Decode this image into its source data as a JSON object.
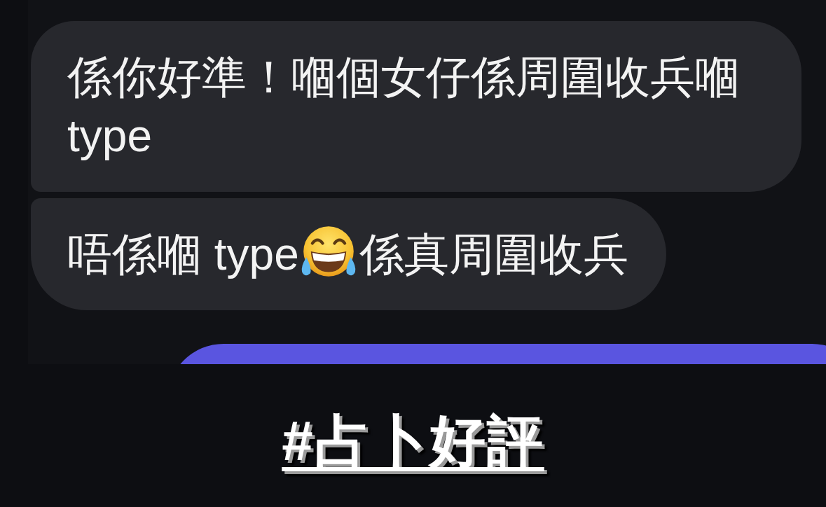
{
  "messages": [
    {
      "kind": "received",
      "parts": [
        {
          "kind": "text",
          "text": "係你好準！嗰個女仔係周圍收兵嗰 type"
        }
      ]
    },
    {
      "kind": "received",
      "parts": [
        {
          "kind": "text",
          "text": "唔係嗰 type"
        },
        {
          "kind": "emoji"
        },
        {
          "kind": "text",
          "text": "係真周圍收兵"
        }
      ]
    },
    {
      "kind": "sent"
    }
  ],
  "caption": {
    "text": "#占卜好評"
  }
}
